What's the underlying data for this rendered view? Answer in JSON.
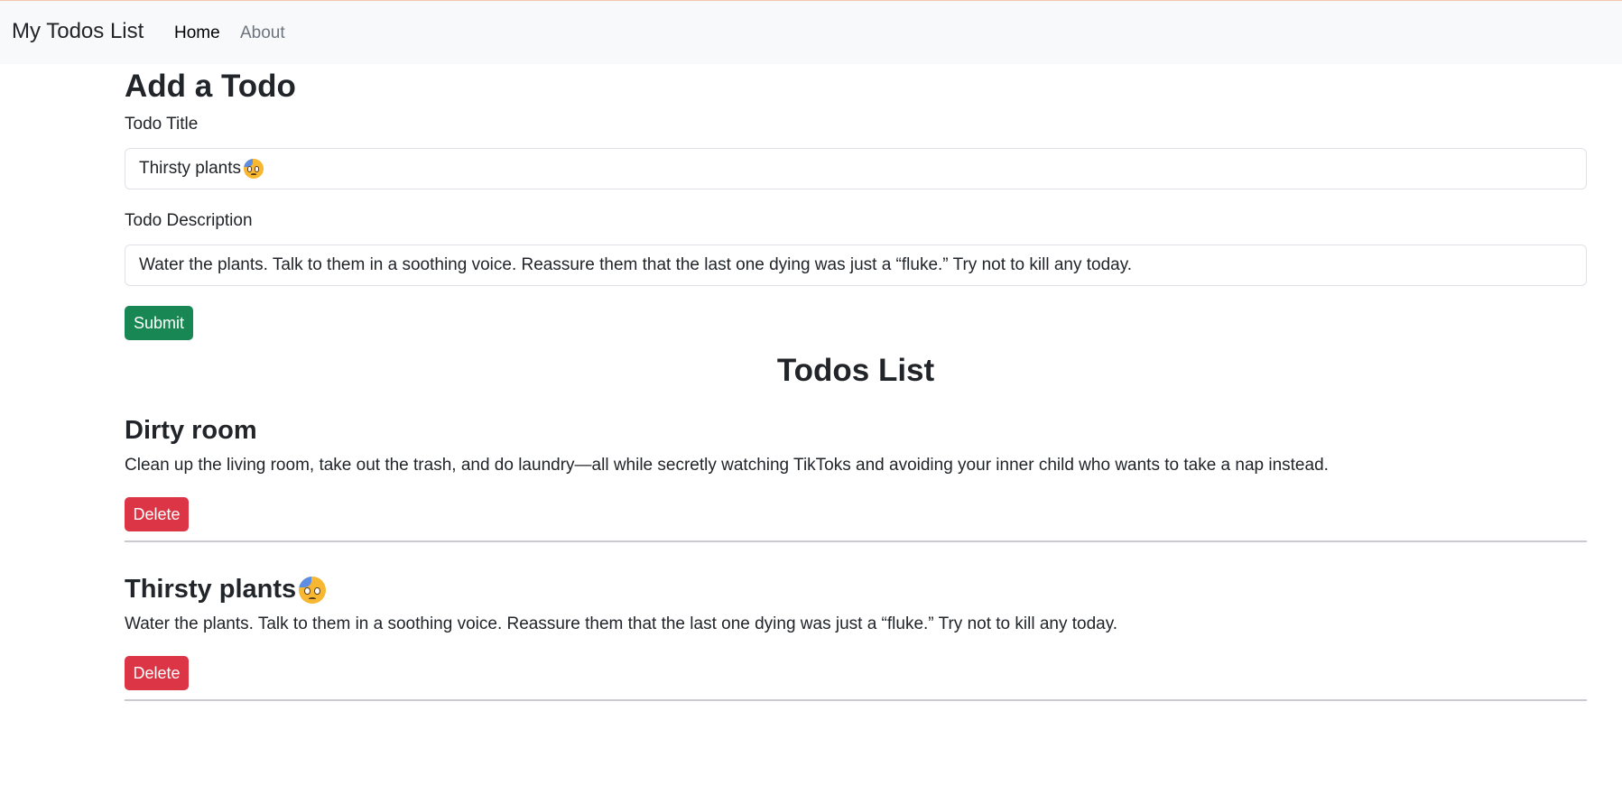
{
  "navbar": {
    "brand": "My Todos List",
    "links": [
      {
        "label": "Home",
        "active": true
      },
      {
        "label": "About",
        "active": false
      }
    ]
  },
  "form": {
    "heading": "Add a Todo",
    "title_label": "Todo Title",
    "title_value": "Thirsty plants",
    "title_emoji": "anxious-sweat-face-icon",
    "desc_label": "Todo Description",
    "desc_value": "Water the plants. Talk to them in a soothing voice. Reassure them that the last one dying was just a “fluke.” Try not to kill any today.",
    "submit_label": "Submit"
  },
  "list": {
    "heading": "Todos List",
    "items": [
      {
        "title": "Dirty room",
        "description": "Clean up the living room, take out the trash, and do laundry—all while secretly watching TikToks and avoiding your inner child who wants to take a nap instead.",
        "delete_label": "Delete"
      },
      {
        "title": "Thirsty plants",
        "emoji": "anxious-sweat-face-icon",
        "description": "Water the plants. Talk to them in a soothing voice. Reassure them that the last one dying was just a “fluke.” Try not to kill any today.",
        "delete_label": "Delete"
      }
    ]
  },
  "colors": {
    "navbar_bg": "#f8f9fa",
    "submit": "#198754",
    "delete": "#dc3545",
    "text": "#212529",
    "muted_link": "#6c757d"
  }
}
